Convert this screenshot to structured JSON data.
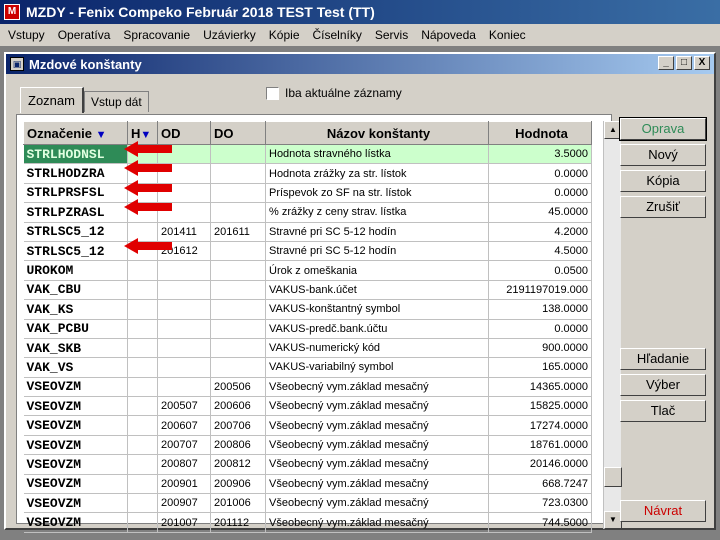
{
  "app": {
    "title": "MZDY - Fenix Compeko Február 2018   TEST Test (TT)",
    "icon_letter": "M"
  },
  "menu": [
    "Vstupy",
    "Operatíva",
    "Spracovanie",
    "Uzávierky",
    "Kópie",
    "Číselníky",
    "Servis",
    "Nápoveda",
    "Koniec"
  ],
  "window": {
    "title": "Mzdové konštanty",
    "minimize": "_",
    "maximize": "□",
    "close": "X"
  },
  "tabs": [
    "Zoznam",
    "Vstup dát"
  ],
  "filter": {
    "label": "Iba aktuálne záznamy",
    "checked": false
  },
  "table": {
    "headers": {
      "oznacenie": "Označenie",
      "h": "H",
      "od": "OD",
      "do": "DO",
      "nazov": "Názov konštanty",
      "hodnota": "Hodnota"
    },
    "rows": [
      {
        "code": "STRLHODNSL",
        "od": "",
        "do": "",
        "name": "Hodnota stravného lístka",
        "value": "3.5000"
      },
      {
        "code": "STRLHODZRA",
        "od": "",
        "do": "",
        "name": "Hodnota zrážky za str. lístok",
        "value": "0.0000"
      },
      {
        "code": "STRLPRSFSL",
        "od": "",
        "do": "",
        "name": "Príspevok zo SF na str. lístok",
        "value": "0.0000"
      },
      {
        "code": "STRLPZRASL",
        "od": "",
        "do": "",
        "name": "% zrážky z ceny strav. lístka",
        "value": "45.0000"
      },
      {
        "code": "STRLSC5_12",
        "od": "201411",
        "do": "201611",
        "name": "Stravné pri SC 5-12 hodín",
        "value": "4.2000"
      },
      {
        "code": "STRLSC5_12",
        "od": "201612",
        "do": "",
        "name": "Stravné pri SC 5-12 hodín",
        "value": "4.5000"
      },
      {
        "code": "UROKOM",
        "od": "",
        "do": "",
        "name": "Úrok z omeškania",
        "value": "0.0500"
      },
      {
        "code": "VAK_CBU",
        "od": "",
        "do": "",
        "name": "VAKUS-bank.účet",
        "value": "2191197019.000"
      },
      {
        "code": "VAK_KS",
        "od": "",
        "do": "",
        "name": "VAKUS-konštantný symbol",
        "value": "138.0000"
      },
      {
        "code": "VAK_PCBU",
        "od": "",
        "do": "",
        "name": "VAKUS-predč.bank.účtu",
        "value": "0.0000"
      },
      {
        "code": "VAK_SKB",
        "od": "",
        "do": "",
        "name": "VAKUS-numerický kód",
        "value": "900.0000"
      },
      {
        "code": "VAK_VS",
        "od": "",
        "do": "",
        "name": "VAKUS-variabilný symbol",
        "value": "165.0000"
      },
      {
        "code": "VSEOVZM",
        "od": "",
        "do": "200506",
        "name": "Všeobecný vym.základ mesačný",
        "value": "14365.0000"
      },
      {
        "code": "VSEOVZM",
        "od": "200507",
        "do": "200606",
        "name": "Všeobecný vym.základ mesačný",
        "value": "15825.0000"
      },
      {
        "code": "VSEOVZM",
        "od": "200607",
        "do": "200706",
        "name": "Všeobecný vym.základ mesačný",
        "value": "17274.0000"
      },
      {
        "code": "VSEOVZM",
        "od": "200707",
        "do": "200806",
        "name": "Všeobecný vym.základ mesačný",
        "value": "18761.0000"
      },
      {
        "code": "VSEOVZM",
        "od": "200807",
        "do": "200812",
        "name": "Všeobecný vym.základ mesačný",
        "value": "20146.0000"
      },
      {
        "code": "VSEOVZM",
        "od": "200901",
        "do": "200906",
        "name": "Všeobecný vym.základ mesačný",
        "value": "668.7247"
      },
      {
        "code": "VSEOVZM",
        "od": "200907",
        "do": "201006",
        "name": "Všeobecný vym.základ mesačný",
        "value": "723.0300"
      },
      {
        "code": "VSEOVZM",
        "od": "201007",
        "do": "201112",
        "name": "Všeobecný vym.základ mesačný",
        "value": "744.5000"
      }
    ]
  },
  "buttons": {
    "oprava": "Oprava",
    "novy": "Nový",
    "kopia": "Kópia",
    "zrusit": "Zrušiť",
    "hladanie": "Hľadanie",
    "vyber": "Výber",
    "tlac": "Tlač",
    "navrat": "Návrat"
  },
  "colors": {
    "selected_row": "#ccffcc",
    "selected_code": "#2e8b57",
    "arrow": "#e00000",
    "oprava": "#2e8b57",
    "navrat": "#cc0000"
  }
}
